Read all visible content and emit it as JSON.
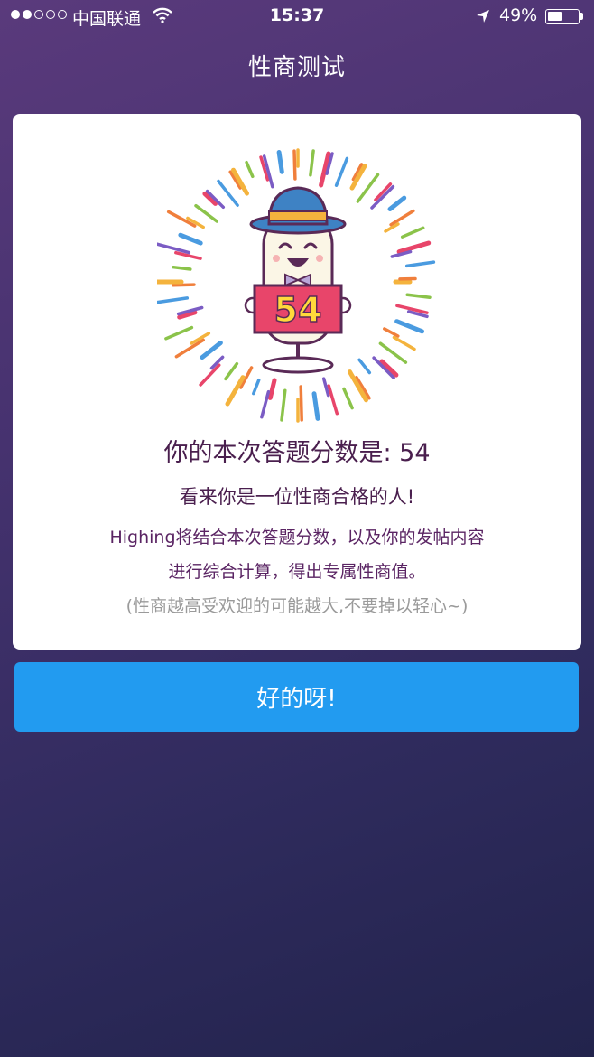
{
  "status_bar": {
    "carrier": "中国联通",
    "time": "15:37",
    "battery": "49%",
    "battery_level": 0.49
  },
  "nav": {
    "title": "性商测试"
  },
  "result": {
    "badge_score": "54",
    "score_line": "你的本次答题分数是: 54",
    "verdict": "看来你是一位性商合格的人!",
    "desc_line1": "Highing将结合本次答题分数，以及你的发帖内容",
    "desc_line2": "进行综合计算，得出专属性商值。",
    "note": "(性商越高受欢迎的可能越大,不要掉以轻心~)"
  },
  "actions": {
    "ok_label": "好的呀!"
  },
  "colors": {
    "accent": "#229bf0",
    "text_purple": "#4a1f4e",
    "badge_red": "#e8456a",
    "badge_yellow": "#ffd93b",
    "hat_blue": "#3e82c4"
  },
  "icons": [
    "wifi-icon",
    "location-arrow-icon",
    "battery-icon",
    "mascot-illustration"
  ]
}
